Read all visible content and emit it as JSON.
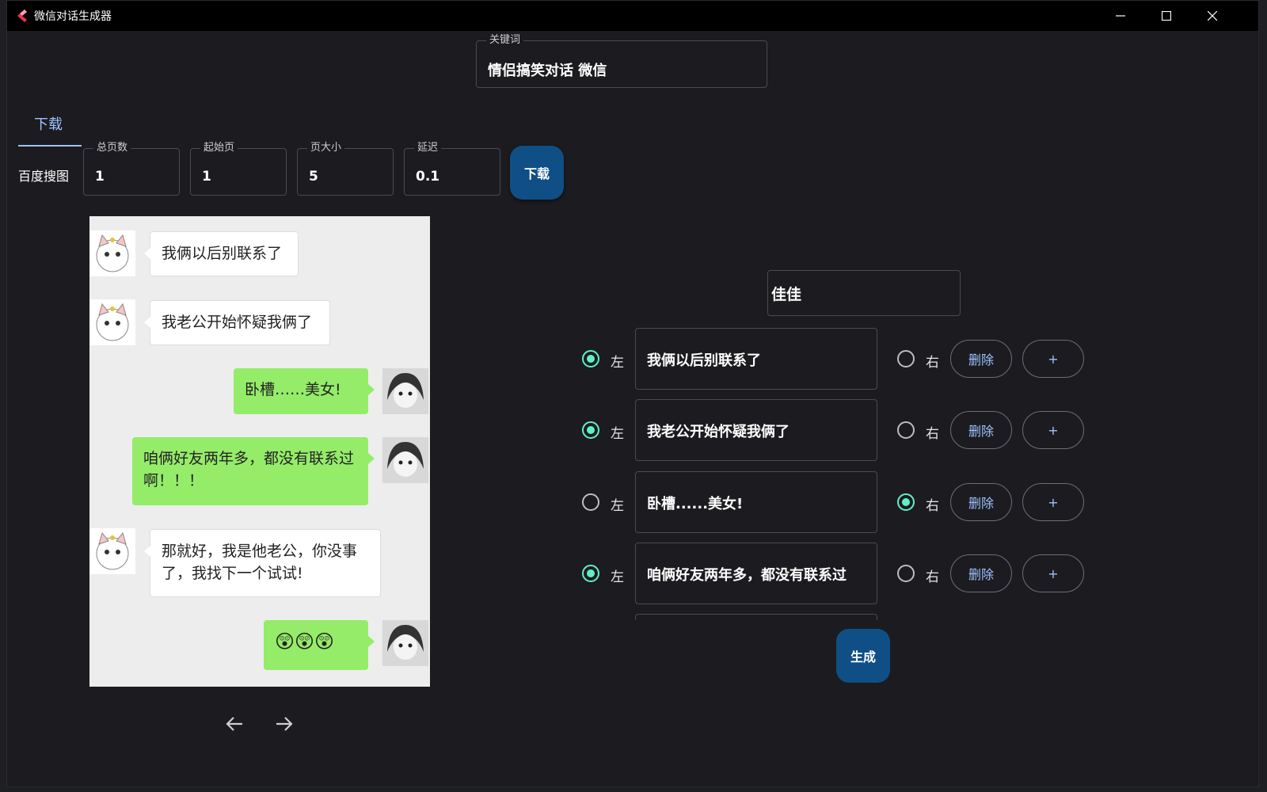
{
  "window": {
    "title": "微信对话生成器"
  },
  "keyword": {
    "label": "关键词",
    "value": "情侣搞笑对话 微信"
  },
  "tabs": [
    {
      "label": "下载"
    }
  ],
  "download_panel": {
    "source_label": "百度搜图",
    "fields": [
      {
        "label": "总页数",
        "value": "1"
      },
      {
        "label": "起始页",
        "value": "1"
      },
      {
        "label": "页大小",
        "value": "5"
      },
      {
        "label": "延迟",
        "value": "0.1"
      }
    ],
    "download_button": "下载"
  },
  "preview": {
    "messages": [
      {
        "side": "left",
        "text": "我俩以后别联系了"
      },
      {
        "side": "left",
        "text": "我老公开始怀疑我俩了"
      },
      {
        "side": "right",
        "text": "卧槽……美女!"
      },
      {
        "side": "right",
        "text": "咱俩好友两年多，都没有联系过啊！！！"
      },
      {
        "side": "left",
        "text": "那就好，我是他老公，你没事了，我找下一个试试!"
      },
      {
        "side": "right",
        "text": "😲😲😲"
      }
    ]
  },
  "editor": {
    "name": "佳佳",
    "left_label": "左",
    "right_label": "右",
    "delete_label": "删除",
    "add_label": "+",
    "rows": [
      {
        "text": "我俩以后别联系了",
        "selected": "left"
      },
      {
        "text": "我老公开始怀疑我俩了",
        "selected": "left"
      },
      {
        "text": "卧槽......美女!",
        "selected": "right"
      },
      {
        "text": "咱俩好友两年多，都没有联系过",
        "selected": "left"
      }
    ],
    "generate_button": "生成"
  },
  "colors": {
    "accent": "#5ff0c8",
    "primary_button": "#0f4f85",
    "tab": "#9cc3ff",
    "bubble_right": "#95ec69"
  }
}
